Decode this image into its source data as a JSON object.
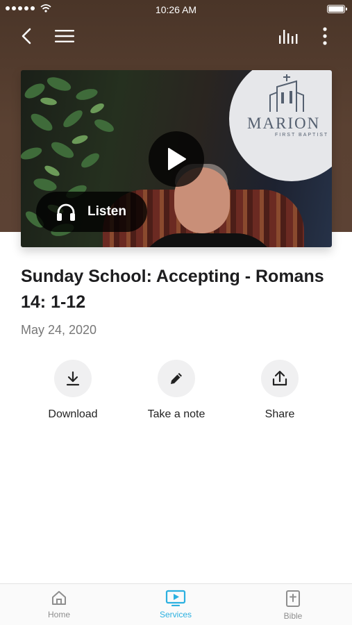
{
  "status_bar": {
    "time": "10:26 AM"
  },
  "media": {
    "listen_label": "Listen",
    "logo_text": "MARION",
    "logo_subtext": "FIRST BAPTIST"
  },
  "sermon": {
    "title": "Sunday School: Accepting - Romans 14: 1-12",
    "date": "May 24, 2020"
  },
  "actions": [
    {
      "label": "Download",
      "icon": "download-icon"
    },
    {
      "label": "Take a note",
      "icon": "pencil-icon"
    },
    {
      "label": "Share",
      "icon": "share-icon"
    }
  ],
  "tabs": [
    {
      "label": "Home",
      "icon": "home-icon",
      "active": false
    },
    {
      "label": "Services",
      "icon": "tv-play-icon",
      "active": true
    },
    {
      "label": "Bible",
      "icon": "bible-icon",
      "active": false
    }
  ],
  "colors": {
    "accent": "#2bb0e0",
    "header_bg": "#5a4132"
  }
}
